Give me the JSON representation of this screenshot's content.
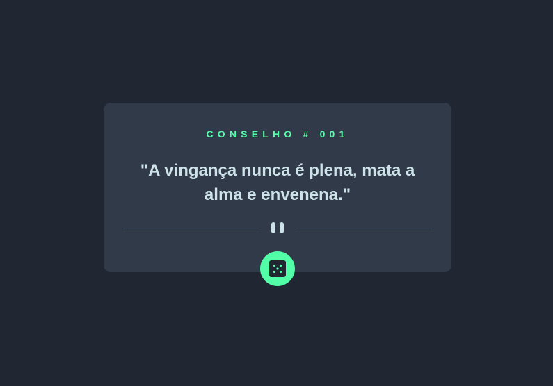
{
  "card": {
    "advice_id": "CONSELHO # 001",
    "advice_text": "\"A vingança nunca é plena, mata a alma e envenena.\""
  },
  "icons": {
    "divider": "pause-icon",
    "button": "dice-icon"
  },
  "colors": {
    "background": "#202632",
    "card": "#313a49",
    "accent": "#52ffa8",
    "text": "#cee3e9",
    "divider": "#4f5d74"
  }
}
